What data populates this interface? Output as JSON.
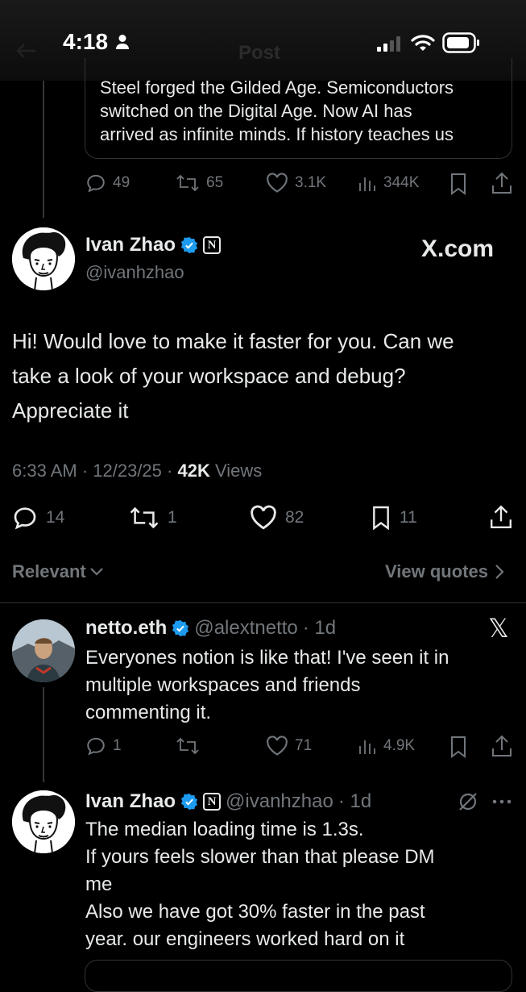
{
  "status_bar": {
    "time": "4:18"
  },
  "header": {
    "title": "Post"
  },
  "quoted_post": {
    "lines": [
      "Steel forged the Gilded Age. Semiconductors",
      "switched on the Digital Age. Now AI has",
      "arrived as infinite minds. If history teaches us"
    ]
  },
  "quoted_actions": {
    "replies": "49",
    "reposts": "65",
    "likes": "3.1K",
    "views": "344K"
  },
  "main_post": {
    "author_name": "Ivan Zhao",
    "handle": "@ivanhzhao",
    "watermark": "X.com",
    "text_lines": [
      "Hi! Would love to make it faster for you. Can we",
      "take a look of your workspace and debug?",
      "Appreciate it"
    ],
    "meta_time": "6:33 AM · 12/23/25 · ",
    "meta_views_count": "42K",
    "meta_views_label": " Views",
    "replies": "14",
    "reposts": "1",
    "likes": "82",
    "bookmarks": "11"
  },
  "filter_bar": {
    "sort_label": "Relevant",
    "view_quotes": "View quotes"
  },
  "reply1": {
    "author_name": "netto.eth",
    "handle": "@alextnetto",
    "dot_time": "· 1d",
    "text_lines": [
      "Everyones notion is like that! I've seen it in",
      "multiple workspaces and friends",
      "commenting it."
    ],
    "replies": "1",
    "reposts": "",
    "likes": "71",
    "views": "4.9K"
  },
  "reply2": {
    "author_name": "Ivan Zhao",
    "handle": "@ivanhzhao",
    "dot_time": "· 1d",
    "text_lines": [
      "The median loading time is 1.3s.",
      "If yours feels slower than that please DM",
      "me",
      "Also we have got 30% faster in the past",
      "year. our engineers worked hard on it"
    ]
  },
  "colors": {
    "accent": "#1d9bf0",
    "muted": "#71767b",
    "text": "#e7e9ea",
    "background": "#000000"
  }
}
